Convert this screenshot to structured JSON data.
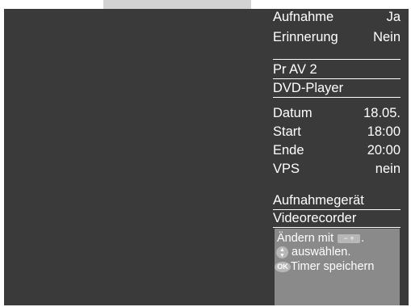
{
  "settings": {
    "aufnahme_label": "Aufnahme",
    "aufnahme_value": "Ja",
    "erinnerung_label": "Erinnerung",
    "erinnerung_value": "Nein"
  },
  "program": {
    "channel": "Pr  AV 2",
    "name": "DVD-Player"
  },
  "schedule": {
    "datum_label": "Datum",
    "datum_value": "18.05.",
    "start_label": "Start",
    "start_value": "18:00",
    "ende_label": "Ende",
    "ende_value": "20:00",
    "vps_label": "VPS",
    "vps_value": "nein"
  },
  "device": {
    "label": "Aufnahmegerät",
    "value": "Videorecorder"
  },
  "help": {
    "change_prefix": "Ändern mit",
    "change_suffix": ".",
    "minus_plus": "− +",
    "select_text": "auswählen.",
    "ok_key": "OK",
    "save_text": "Timer speichern"
  },
  "colors": {
    "tv_background": "#3a3a3a",
    "help_background": "#8a8a8a",
    "text": "#ffffff"
  },
  "icons": {
    "updown": "updown-arrows-icon",
    "ok": "ok-button-icon",
    "minus_plus": "minus-plus-keys-icon"
  }
}
